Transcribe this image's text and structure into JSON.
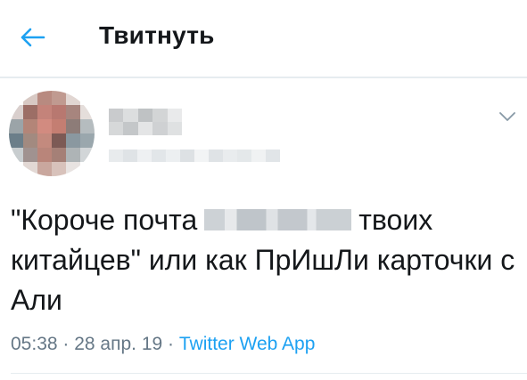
{
  "header": {
    "title": "Твитнуть",
    "back_icon": "arrow-left-icon",
    "accent_color": "#1da1f2"
  },
  "tweet": {
    "text_before": "\"Короче почта",
    "text_after": "твоих китайцев\" или как ПрИшЛи карточки с Али",
    "time": "05:38",
    "separator": " · ",
    "date": "28 апр. 19",
    "source": "Twitter Web App",
    "menu_icon": "chevron-down-icon"
  }
}
